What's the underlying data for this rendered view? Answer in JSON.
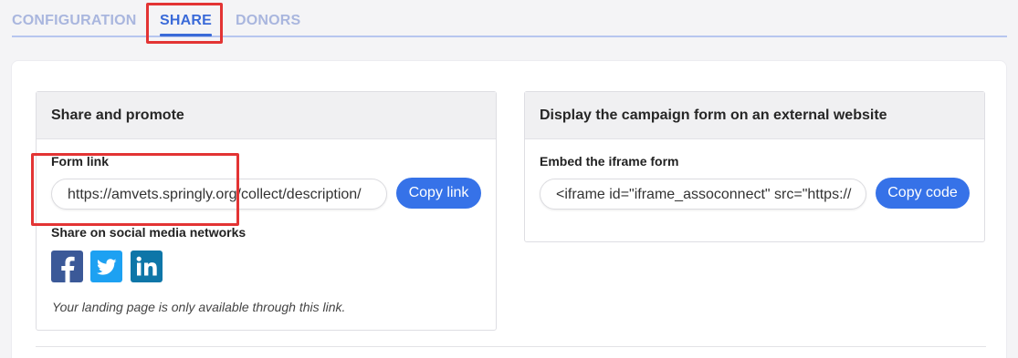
{
  "tabs": {
    "configuration": "CONFIGURATION",
    "share": "SHARE",
    "donors": "DONORS"
  },
  "share_panel": {
    "title": "Share and promote",
    "form_link_label": "Form link",
    "form_link_value": "https://amvets.springly.org/collect/description/",
    "copy_link_label": "Copy link",
    "social_label": "Share on social media networks",
    "social_icons": [
      "facebook-icon",
      "twitter-icon",
      "linkedin-icon"
    ],
    "note": "Your landing page is only available through this link."
  },
  "embed_panel": {
    "title": "Display the campaign form on an external website",
    "embed_label": "Embed the iframe form",
    "embed_value": "<iframe id=\"iframe_assoconnect\" src=\"https://",
    "copy_code_label": "Copy code"
  },
  "colors": {
    "accent": "#3672e8",
    "tab_active": "#3a6ad8",
    "tab_inactive": "#a9b6de",
    "highlight": "#e33434",
    "facebook": "#3b5998",
    "twitter": "#1da1f2",
    "linkedin": "#0e76a8"
  }
}
